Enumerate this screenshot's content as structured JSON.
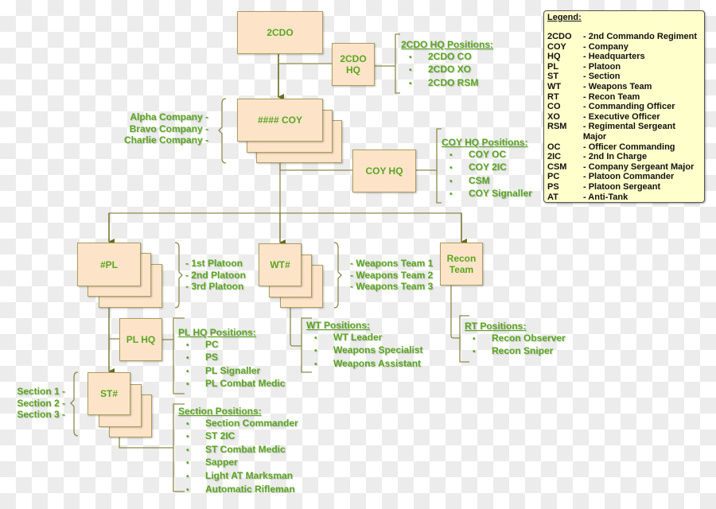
{
  "colors": {
    "text": "#5aa51f",
    "box_fill": "#fde4c9",
    "box_border": "#a99e5c",
    "line": "#8c8a4a",
    "legend_bg": "#ffffcc"
  },
  "nodes": {
    "regiment": "2CDO",
    "regiment_hq": "2CDO HQ",
    "company": "#### COY",
    "company_hq": "COY HQ",
    "platoon": "#PL",
    "weapons_team": "WT#",
    "recon_team": "Recon Team",
    "platoon_hq": "PL HQ",
    "section": "ST#"
  },
  "company_labels": [
    "Alpha Company -",
    "Bravo Company -",
    "Charlie Company -"
  ],
  "platoon_labels": [
    "- 1st Platoon",
    "- 2nd Platoon",
    "- 3rd Platoon"
  ],
  "wt_labels": [
    "- Weapons Team 1",
    "- Weapons Team 2",
    "- Weapons Team 3"
  ],
  "section_labels": [
    "Section 1 -",
    "Section 2 -",
    "Section 3 -"
  ],
  "regiment_hq_positions": {
    "title": "2CDO HQ Positions:",
    "items": [
      "2CDO CO",
      "2CDO XO",
      "2CDO RSM"
    ]
  },
  "company_hq_positions": {
    "title": "COY HQ Positions:",
    "items": [
      "COY OC",
      "COY 2IC",
      "CSM",
      "COY Signaller"
    ]
  },
  "platoon_hq_positions": {
    "title": "PL HQ Positions:",
    "items": [
      "PC",
      "PS",
      "PL Signaller",
      "PL Combat Medic"
    ]
  },
  "wt_positions": {
    "title": "WT Positions:",
    "items": [
      "WT Leader",
      "Weapons Specialist",
      "Weapons Assistant"
    ]
  },
  "rt_positions": {
    "title": "RT Positions:",
    "items": [
      "Recon Observer",
      "Recon Sniper"
    ]
  },
  "section_positions": {
    "title": "Section Positions:",
    "items": [
      "Section Commander",
      "ST 2IC",
      "ST Combat Medic",
      "Sapper",
      "Light AT Marksman",
      "Automatic Rifleman"
    ]
  },
  "legend": {
    "title": "Legend:",
    "entries": [
      {
        "abbr": "2CDO",
        "meaning": "- 2nd Commando Regiment"
      },
      {
        "abbr": "COY",
        "meaning": "- Company"
      },
      {
        "abbr": "HQ",
        "meaning": "- Headquarters"
      },
      {
        "abbr": "PL",
        "meaning": "- Platoon"
      },
      {
        "abbr": "ST",
        "meaning": "- Section"
      },
      {
        "abbr": "WT",
        "meaning": "- Weapons Team"
      },
      {
        "abbr": "RT",
        "meaning": "- Recon Team"
      },
      {
        "abbr": "CO",
        "meaning": "- Commanding Officer"
      },
      {
        "abbr": "XO",
        "meaning": "- Executive Officer"
      },
      {
        "abbr": "RSM",
        "meaning": "- Regimental Sergeant Major"
      },
      {
        "abbr": "OC",
        "meaning": "- Officer Commanding"
      },
      {
        "abbr": "2IC",
        "meaning": "- 2nd In Charge"
      },
      {
        "abbr": "CSM",
        "meaning": "- Company Sergeant Major"
      },
      {
        "abbr": "PC",
        "meaning": "- Platoon Commander"
      },
      {
        "abbr": "PS",
        "meaning": "- Platoon Sergeant"
      },
      {
        "abbr": "AT",
        "meaning": "- Anti-Tank"
      }
    ]
  }
}
